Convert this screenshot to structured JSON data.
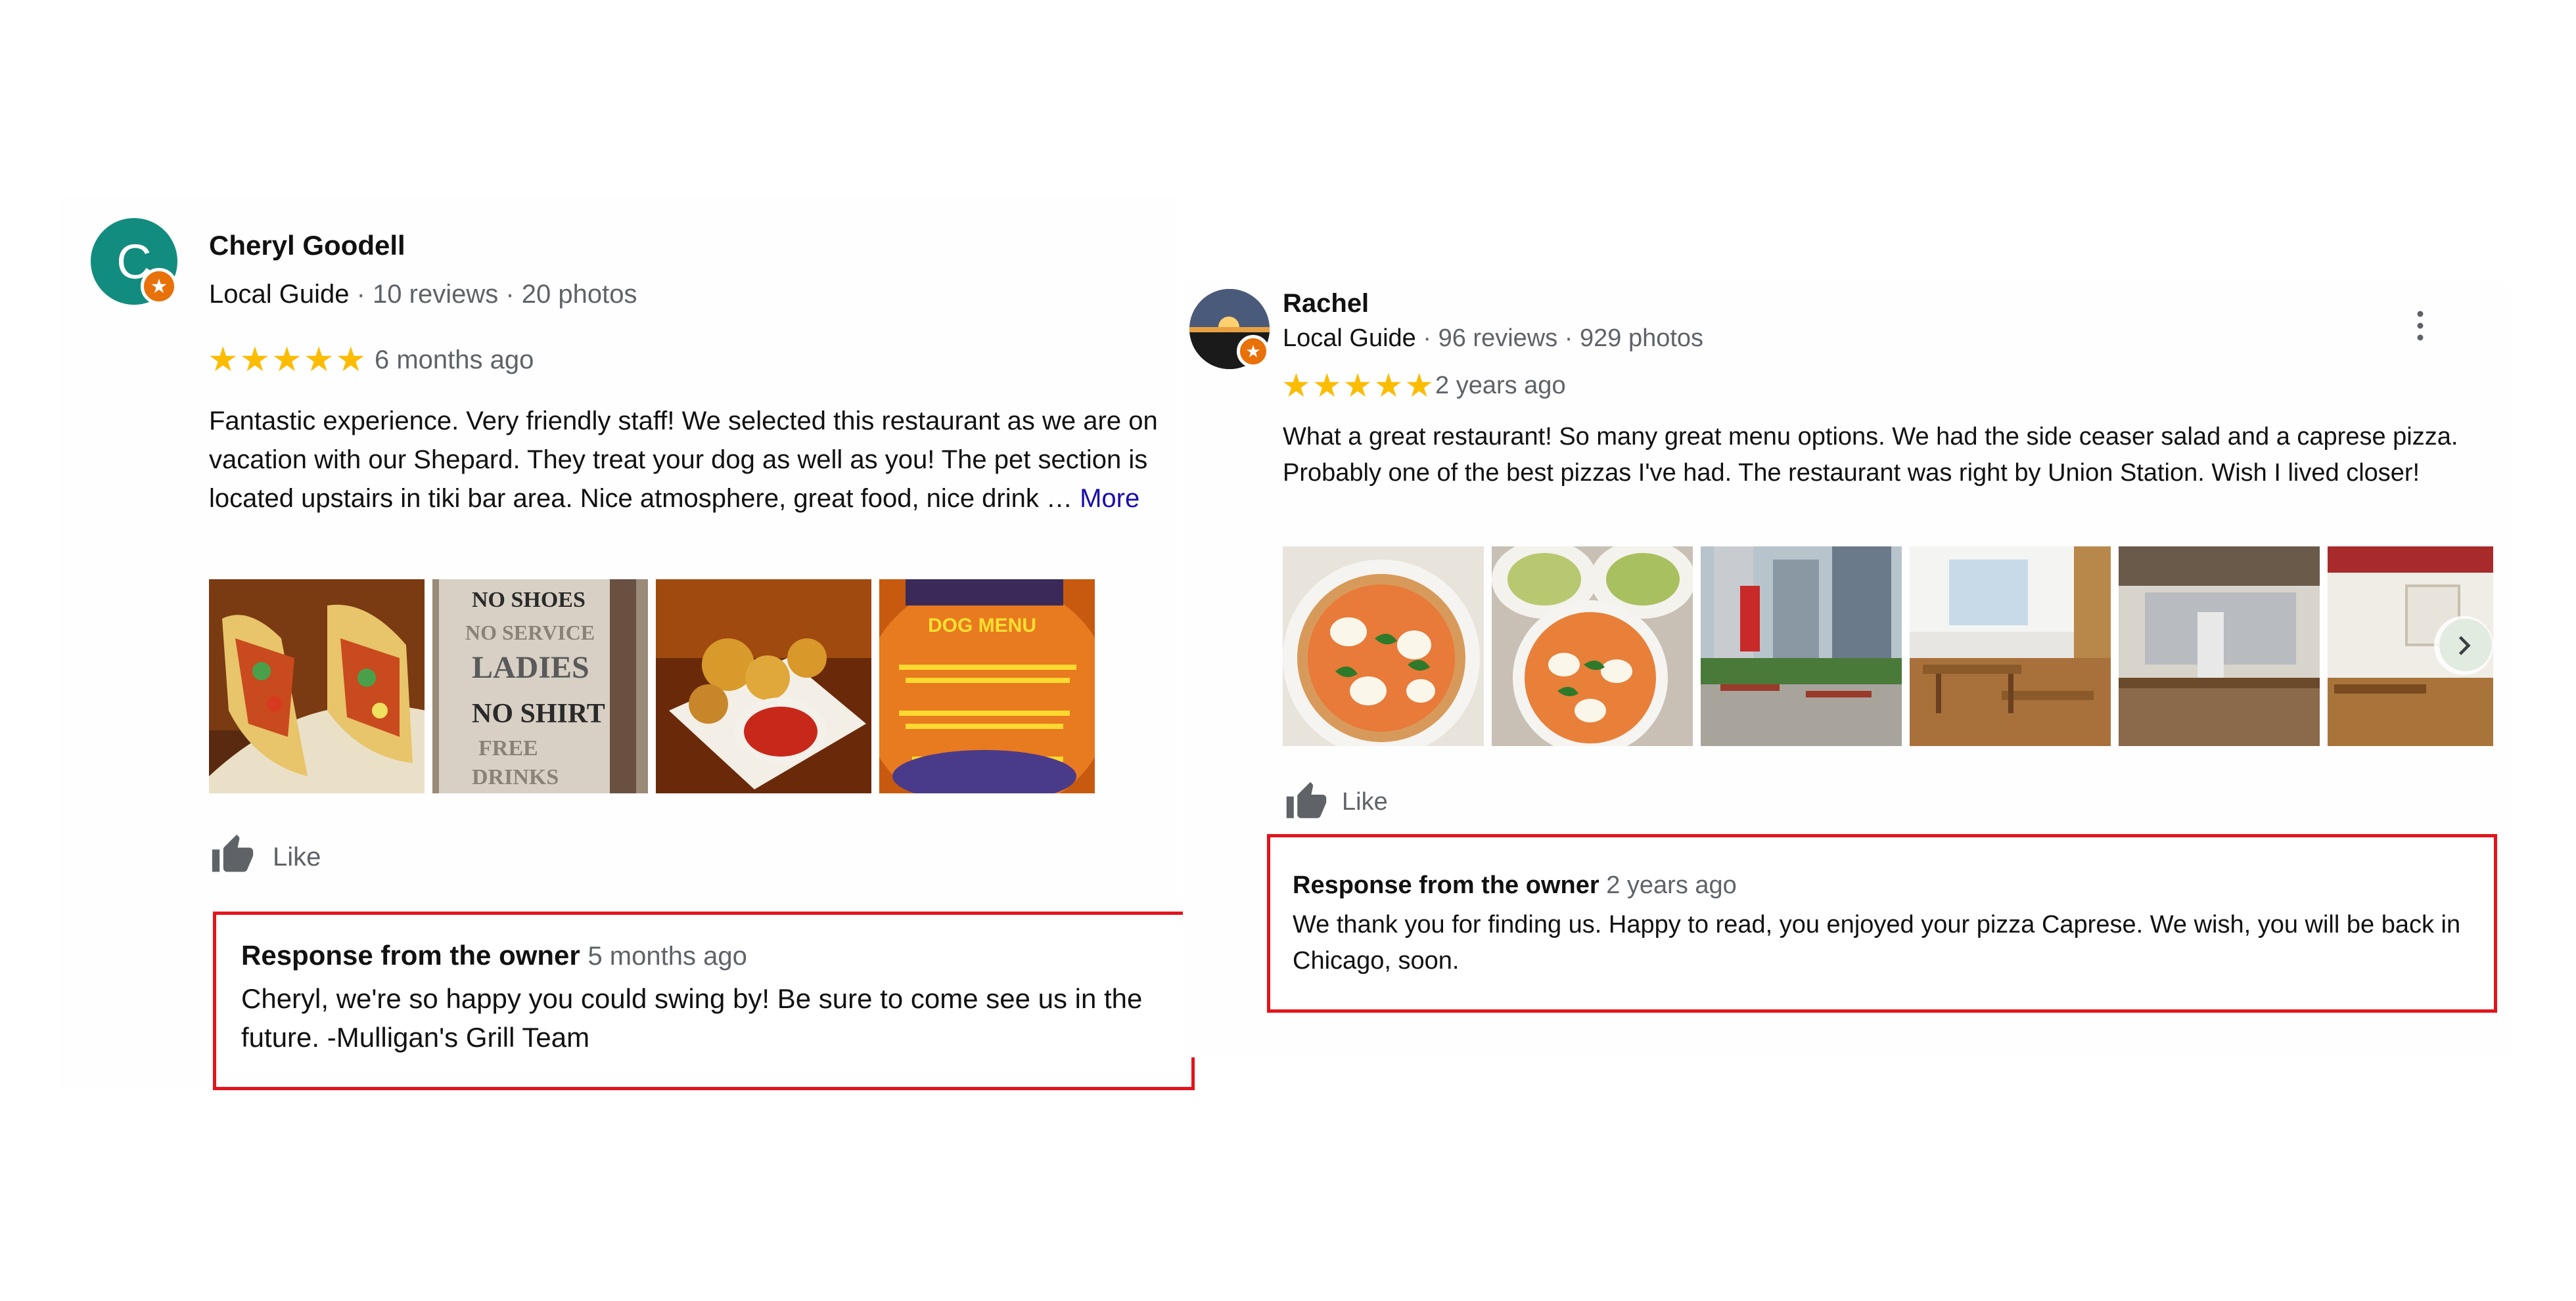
{
  "reviews": [
    {
      "avatar_letter": "C",
      "name": "Cheryl Goodell",
      "guide_label": "Local Guide",
      "stats": "· 10 reviews · 20 photos",
      "stars": "★★★★★",
      "rating": 5,
      "time": "6 months ago",
      "text": "Fantastic experience. Very friendly staff! We selected this restaurant as we are on vacation with our Shepard. They treat your dog as well as you! The pet section is located upstairs in tiki bar area. Nice atmosphere, great food, nice drink … ",
      "more_label": "More",
      "photos": [
        {
          "name": "tacos-photo",
          "sign_text": ""
        },
        {
          "name": "sign-photo",
          "sign_text": "NO SHOES NO SERVICE LADIES NO SHIRT FREE DRINKS"
        },
        {
          "name": "fries-photo",
          "sign_text": ""
        },
        {
          "name": "dog-menu-photo",
          "sign_text": "DOG MENU"
        }
      ],
      "like_label": "Like",
      "owner_title": "Response from the owner",
      "owner_time": "5 months ago",
      "owner_text": "Cheryl, we're so happy you could swing by! Be sure to come see us in the future. -Mulligan's Grill Team"
    },
    {
      "name": "Rachel",
      "guide_label": "Local Guide",
      "stats": "· 96 reviews · 929 photos",
      "stars": "★★★★★",
      "rating": 5,
      "time": "2 years ago",
      "text": "What a great restaurant! So many great menu options. We had the side ceaser salad and a caprese pizza. Probably one of the best pizzas I've had. The restaurant was right by Union Station. Wish I lived closer!",
      "photos": [
        {
          "name": "pizza-photo"
        },
        {
          "name": "pizza-salad-photo"
        },
        {
          "name": "patio-photo"
        },
        {
          "name": "dining-room-photo"
        },
        {
          "name": "kitchen-photo"
        },
        {
          "name": "interior-photo"
        }
      ],
      "like_label": "Like",
      "owner_title": "Response from the owner",
      "owner_time": "2 years ago",
      "owner_text": "We thank you for finding us. Happy to read, you enjoyed your pizza Caprese. We wish, you will be back in Chicago, soon."
    }
  ],
  "colors": {
    "star": "#fbbc04",
    "highlight_border": "#e3141b",
    "link": "#1a0dab",
    "avatar_bg": "#128c7e",
    "guide_badge": "#e8710a"
  },
  "icons": [
    "guide-badge-icon",
    "thumbs-up-icon",
    "more-vert-icon",
    "chevron-right-icon"
  ]
}
